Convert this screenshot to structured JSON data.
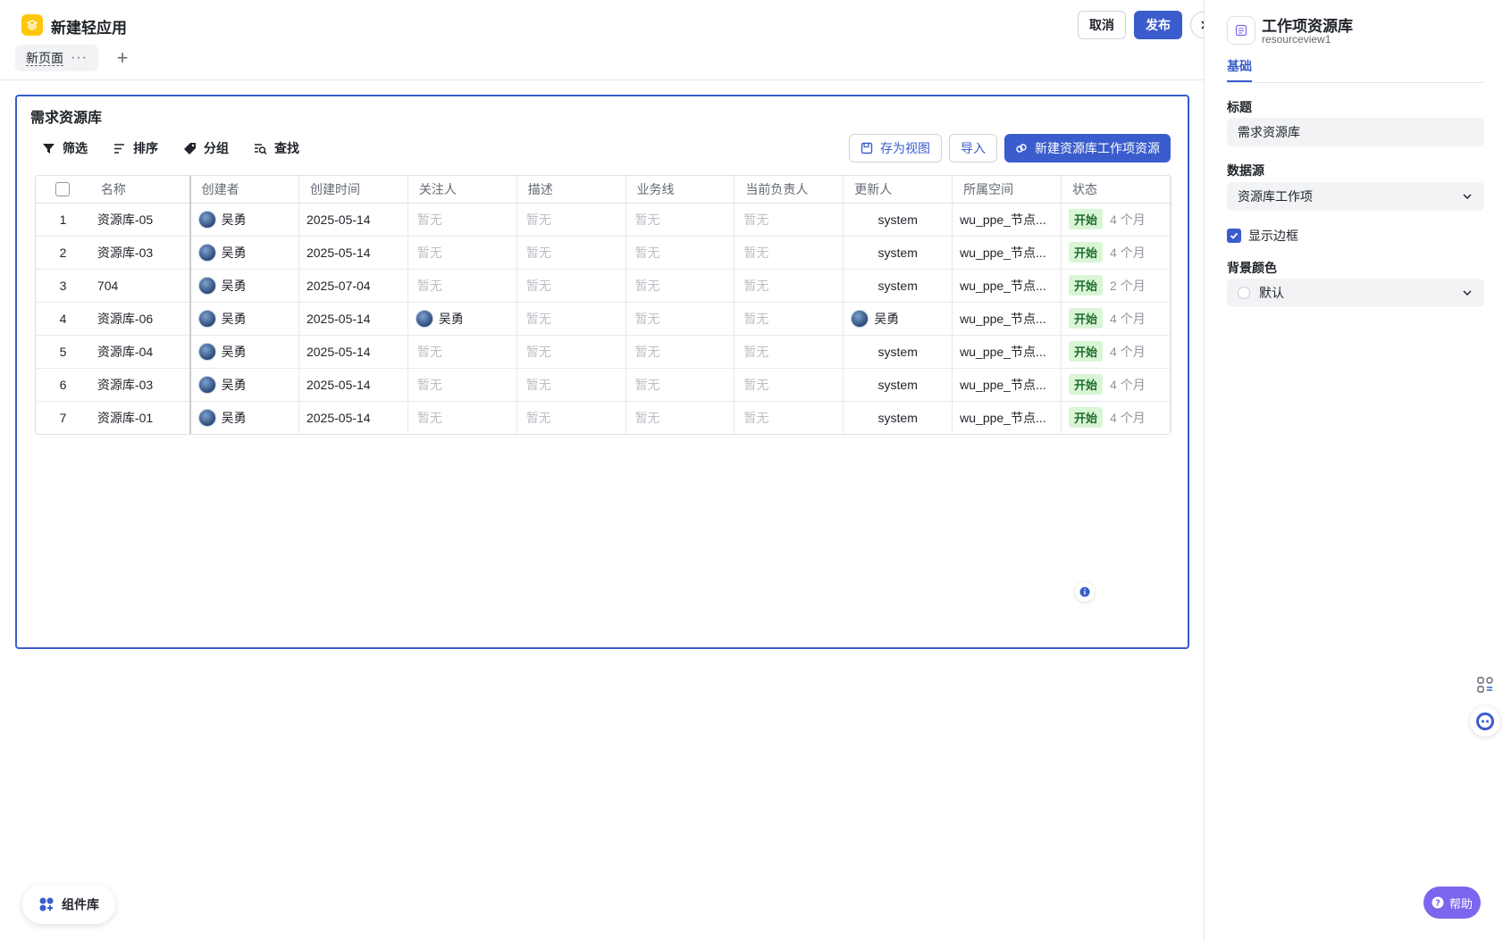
{
  "app": {
    "title": "新建轻应用"
  },
  "page_tabs": [
    {
      "label": "新页面"
    }
  ],
  "header": {
    "cancel_label": "取消",
    "publish_label": "发布"
  },
  "component": {
    "title": "需求资源库",
    "toolbar": {
      "filter": "筛选",
      "sort": "排序",
      "group": "分组",
      "search": "查找"
    },
    "actions": {
      "save_view": "存为视图",
      "import": "导入",
      "new_item": "新建资源库工作项资源"
    },
    "table": {
      "columns": [
        "名称",
        "创建者",
        "创建时间",
        "关注人",
        "描述",
        "业务线",
        "当前负责人",
        "更新人",
        "所属空间",
        "状态"
      ],
      "rows": [
        {
          "no": "1",
          "name": "资源库-05",
          "creator": "吴勇",
          "created": "2025-05-14",
          "follower": "暂无",
          "desc": "暂无",
          "biz": "暂无",
          "owner": "暂无",
          "updater": "system",
          "space": "wu_ppe_节点...",
          "status": "开始",
          "ago": "4 个月"
        },
        {
          "no": "2",
          "name": "资源库-03",
          "creator": "吴勇",
          "created": "2025-05-14",
          "follower": "暂无",
          "desc": "暂无",
          "biz": "暂无",
          "owner": "暂无",
          "updater": "system",
          "space": "wu_ppe_节点...",
          "status": "开始",
          "ago": "4 个月"
        },
        {
          "no": "3",
          "name": "704",
          "creator": "吴勇",
          "created": "2025-07-04",
          "follower": "暂无",
          "desc": "暂无",
          "biz": "暂无",
          "owner": "暂无",
          "updater": "system",
          "space": "wu_ppe_节点...",
          "status": "开始",
          "ago": "2 个月"
        },
        {
          "no": "4",
          "name": "资源库-06",
          "creator": "吴勇",
          "created": "2025-05-14",
          "follower": "吴勇",
          "desc": "暂无",
          "biz": "暂无",
          "owner": "暂无",
          "updater": "吴勇",
          "space": "wu_ppe_节点...",
          "status": "开始",
          "ago": "4 个月"
        },
        {
          "no": "5",
          "name": "资源库-04",
          "creator": "吴勇",
          "created": "2025-05-14",
          "follower": "暂无",
          "desc": "暂无",
          "biz": "暂无",
          "owner": "暂无",
          "updater": "system",
          "space": "wu_ppe_节点...",
          "status": "开始",
          "ago": "4 个月"
        },
        {
          "no": "6",
          "name": "资源库-03",
          "creator": "吴勇",
          "created": "2025-05-14",
          "follower": "暂无",
          "desc": "暂无",
          "biz": "暂无",
          "owner": "暂无",
          "updater": "system",
          "space": "wu_ppe_节点...",
          "status": "开始",
          "ago": "4 个月"
        },
        {
          "no": "7",
          "name": "资源库-01",
          "creator": "吴勇",
          "created": "2025-05-14",
          "follower": "暂无",
          "desc": "暂无",
          "biz": "暂无",
          "owner": "暂无",
          "updater": "system",
          "space": "wu_ppe_节点...",
          "status": "开始",
          "ago": "4 个月"
        }
      ]
    }
  },
  "component_library_label": "组件库",
  "sidebar": {
    "title": "工作项资源库",
    "subtitle": "resourceview1",
    "tab": "基础",
    "title_label": "标题",
    "title_value": "需求资源库",
    "datasource_label": "数据源",
    "datasource_value": "资源库工作项",
    "show_border_label": "显示边框",
    "bg_color_label": "背景颜色",
    "bg_color_value": "默认"
  },
  "help_label": "帮助",
  "colors": {
    "accent": "#3a5ccc",
    "status_green_bg": "#d9f5d6",
    "help_purple": "#7b67ee",
    "logo_yellow": "#ffc60a"
  }
}
